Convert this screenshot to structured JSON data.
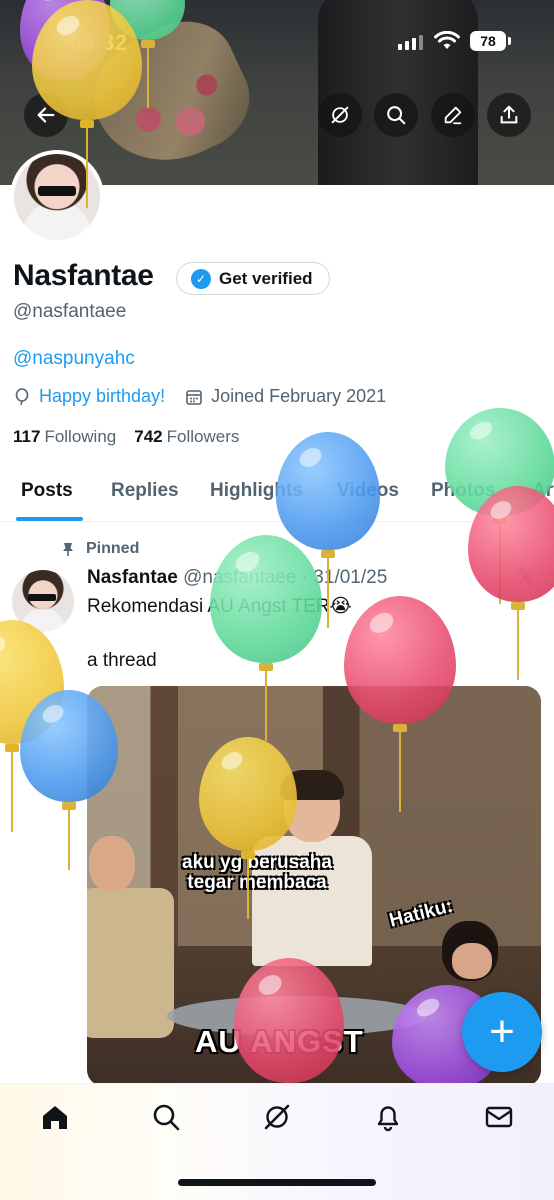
{
  "status_bar": {
    "time": "09.32",
    "battery": "78"
  },
  "profile": {
    "name": "Nasfantae",
    "verify_label": "Get verified",
    "handle": "@nasfantaee",
    "bio_link": "@naspunyahc",
    "birthday": "Happy birthday!",
    "joined": "Joined February 2021",
    "following_count": "117",
    "following_label": "Following",
    "followers_count": "742",
    "followers_label": "Followers"
  },
  "tabs": [
    "Posts",
    "Replies",
    "Highlights",
    "Videos",
    "Photos",
    "Art"
  ],
  "post": {
    "pinned_label": "Pinned",
    "author": "Nasfantae",
    "meta": "@nasfantaee · 31/01/25",
    "text_line1": "Rekomendasi AU Angst TER😭",
    "text_line2": "a thread",
    "meme_text_1": "aku yg berusaha tegar membaca",
    "meme_text_2": "Hatiku:",
    "meme_text_3": "AU ANGST"
  },
  "fab_label": "+",
  "bottom_nav": [
    "home-icon",
    "search-icon",
    "grok-icon",
    "notifications-icon",
    "messages-icon"
  ],
  "colors": {
    "accent": "#1d9bf0",
    "text": "#0f1419",
    "muted": "#536471"
  }
}
